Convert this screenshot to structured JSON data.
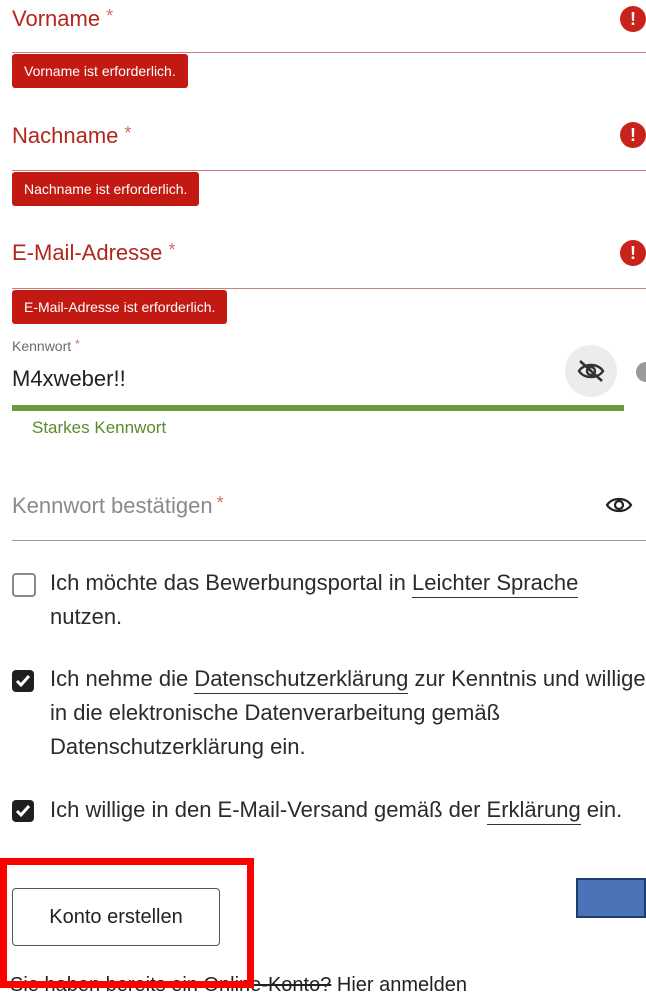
{
  "fields": {
    "vorname": {
      "label": "Vorname",
      "required_mark": "*",
      "error": "Vorname ist erforderlich."
    },
    "nachname": {
      "label": "Nachname",
      "required_mark": "*",
      "error": "Nachname ist erforderlich."
    },
    "email": {
      "label": "E-Mail-Adresse",
      "required_mark": "*",
      "error": "E-Mail-Adresse ist erforderlich."
    },
    "password": {
      "label": "Kennwort",
      "required_mark": "*",
      "value": "M4xweber!!",
      "strength": "Starkes Kennwort"
    },
    "confirm": {
      "label": "Kennwort bestätigen",
      "required_mark": "*"
    }
  },
  "error_icon_glyph": "!",
  "checkboxes": {
    "easy_language": {
      "text_before": "Ich möchte das Bewerbungsportal in ",
      "link": "Leichter Sprache",
      "text_after": " nutzen.",
      "checked": false
    },
    "privacy": {
      "text_before": "Ich nehme die ",
      "link": "Datenschutzerklärung",
      "text_after": " zur Kenntnis und willige in die elektronische Datenverarbeitung gemäß Datenschutzerklärung ein.",
      "checked": true
    },
    "email_consent": {
      "text_before": "Ich willige in den E-Mail-Versand gemäß der ",
      "link": "Erklärung",
      "text_after": " ein.",
      "checked": true
    }
  },
  "create_button": "Konto erstellen",
  "footer": {
    "question": "Sie haben bereits ein Online-Konto?",
    "login_link": "Hier anmelden"
  },
  "colors": {
    "error": "#c21a12",
    "strength": "#6d9a3b",
    "highlight": "#ff0000",
    "blue_box": "#4b73b8"
  }
}
